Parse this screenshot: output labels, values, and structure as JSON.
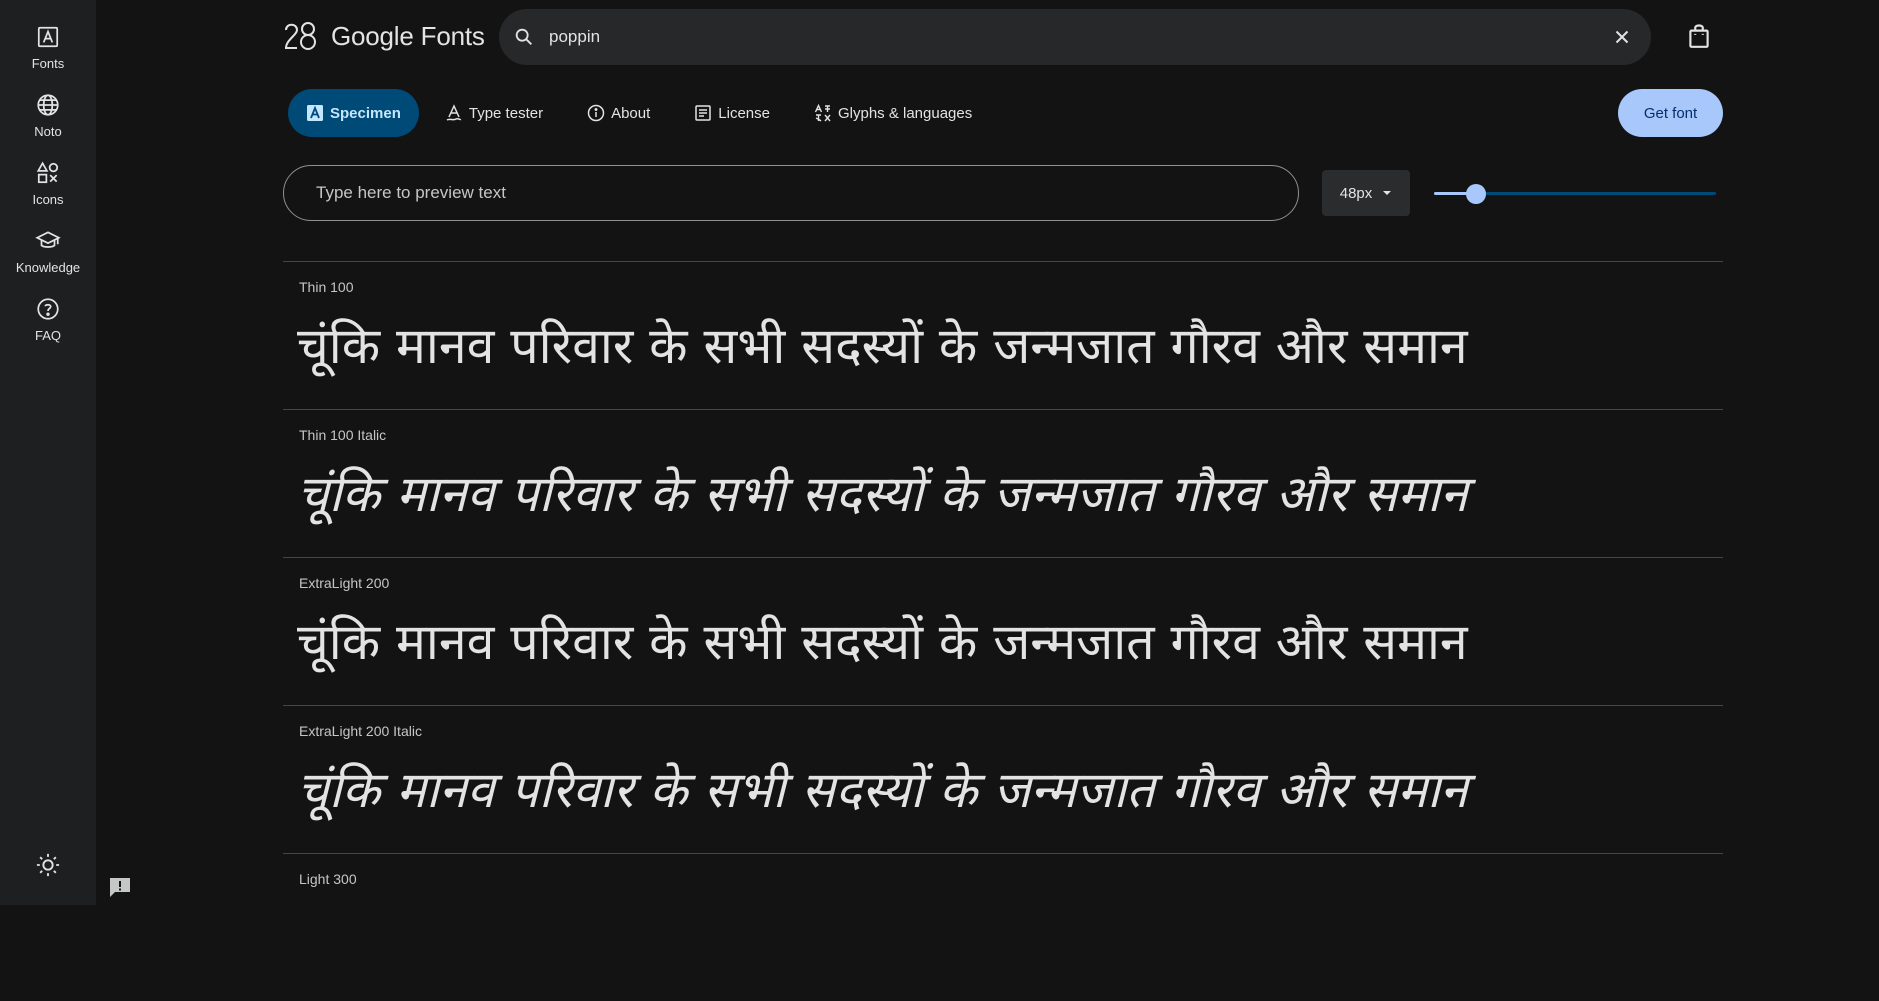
{
  "rail": {
    "items": [
      {
        "label": "Fonts",
        "icon": "font-icon"
      },
      {
        "label": "Noto",
        "icon": "globe-icon"
      },
      {
        "label": "Icons",
        "icon": "shapes-icon"
      },
      {
        "label": "Knowledge",
        "icon": "graduation-cap-icon"
      },
      {
        "label": "FAQ",
        "icon": "help-circle-icon"
      }
    ]
  },
  "header": {
    "logo_text": "Google Fonts",
    "search_value": "poppin"
  },
  "tabs": [
    {
      "label": "Specimen",
      "icon": "specimen-icon",
      "active": true
    },
    {
      "label": "Type tester",
      "icon": "type-tester-icon",
      "active": false
    },
    {
      "label": "About",
      "icon": "info-icon",
      "active": false
    },
    {
      "label": "License",
      "icon": "license-icon",
      "active": false
    },
    {
      "label": "Glyphs & languages",
      "icon": "glyphs-icon",
      "active": false
    }
  ],
  "get_font_label": "Get font",
  "preview": {
    "placeholder": "Type here to preview text",
    "size_label": "48px",
    "slider_level": 0.15
  },
  "sample_text": "चूंकि मानव परिवार के सभी सदस्यों के जन्मजात गौरव और समान",
  "styles": [
    {
      "label": "Thin 100"
    },
    {
      "label": "Thin 100 Italic"
    },
    {
      "label": "ExtraLight 200"
    },
    {
      "label": "ExtraLight 200 Italic"
    },
    {
      "label": "Light 300"
    }
  ],
  "colors": {
    "background": "#131314",
    "rail": "#1e1f20",
    "accent": "#a8c7fa",
    "active_tab": "#004a77"
  }
}
